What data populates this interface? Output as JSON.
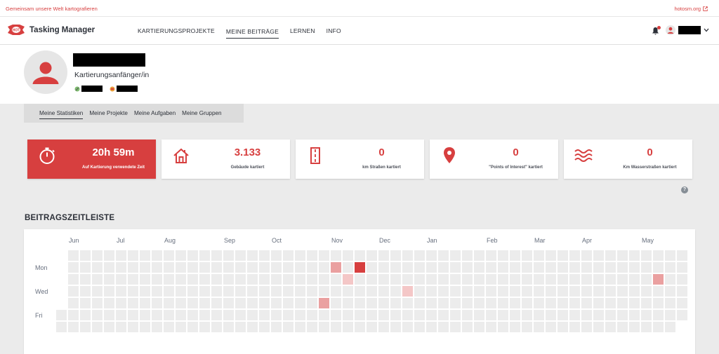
{
  "topbar": {
    "tagline": "Gemeinsam unsere Welt kartografieren",
    "site_link": "hotosm.org",
    "external_icon": "external-link-icon"
  },
  "header": {
    "brand": "Tasking Manager",
    "logo_icon": "hot-logo-icon",
    "nav": [
      "KARTIERUNGSPROJEKTE",
      "MEINE BEITRÄGE",
      "LERNEN",
      "INFO"
    ],
    "active_nav_index": 1,
    "notification_icon": "bell-icon",
    "user_avatar_icon": "user-icon",
    "dropdown_icon": "chevron-down-icon"
  },
  "profile": {
    "level": "Kartierungsanfänger/in",
    "avatar_icon": "user-silhouette-icon",
    "badge_icons": [
      "osm-icon",
      "tm-icon"
    ]
  },
  "tabs": [
    "Meine Statistiken",
    "Meine Projekte",
    "Meine Aufgaben",
    "Meine Gruppen"
  ],
  "active_tab_index": 0,
  "stats": [
    {
      "value": "20h 59m",
      "label": "Auf Kartierung verwendete Zeit",
      "icon": "stopwatch-icon"
    },
    {
      "value": "3.133",
      "label": "Gebäude kartiert",
      "icon": "house-icon"
    },
    {
      "value": "0",
      "label": "km Straßen kartiert",
      "icon": "road-icon"
    },
    {
      "value": "0",
      "label": "\"Points of Interest\" kartiert",
      "icon": "map-pin-icon"
    },
    {
      "value": "0",
      "label": "Km Wasserstraßen kartiert",
      "icon": "waves-icon"
    }
  ],
  "help_label": "?",
  "timeline": {
    "title": "BEITRAGSZEITLEISTE",
    "months": [
      "Jun",
      "Jul",
      "Aug",
      "Sep",
      "Oct",
      "Nov",
      "Dec",
      "Jan",
      "Feb",
      "Mar",
      "Apr",
      "May"
    ],
    "day_labels": [
      "Mon",
      "Wed",
      "Fri"
    ],
    "weeks": 53,
    "colors": {
      "empty": "#ececec",
      "low": "#f4c7c7",
      "mid": "#eaa0a0",
      "high": "#d73f3f"
    },
    "active_cells": [
      {
        "week": 23,
        "day": 1,
        "level": "mid"
      },
      {
        "week": 24,
        "day": 2,
        "level": "low"
      },
      {
        "week": 25,
        "day": 1,
        "level": "high"
      },
      {
        "week": 22,
        "day": 4,
        "level": "mid"
      },
      {
        "week": 29,
        "day": 3,
        "level": "low"
      },
      {
        "week": 50,
        "day": 2,
        "level": "mid"
      }
    ]
  }
}
